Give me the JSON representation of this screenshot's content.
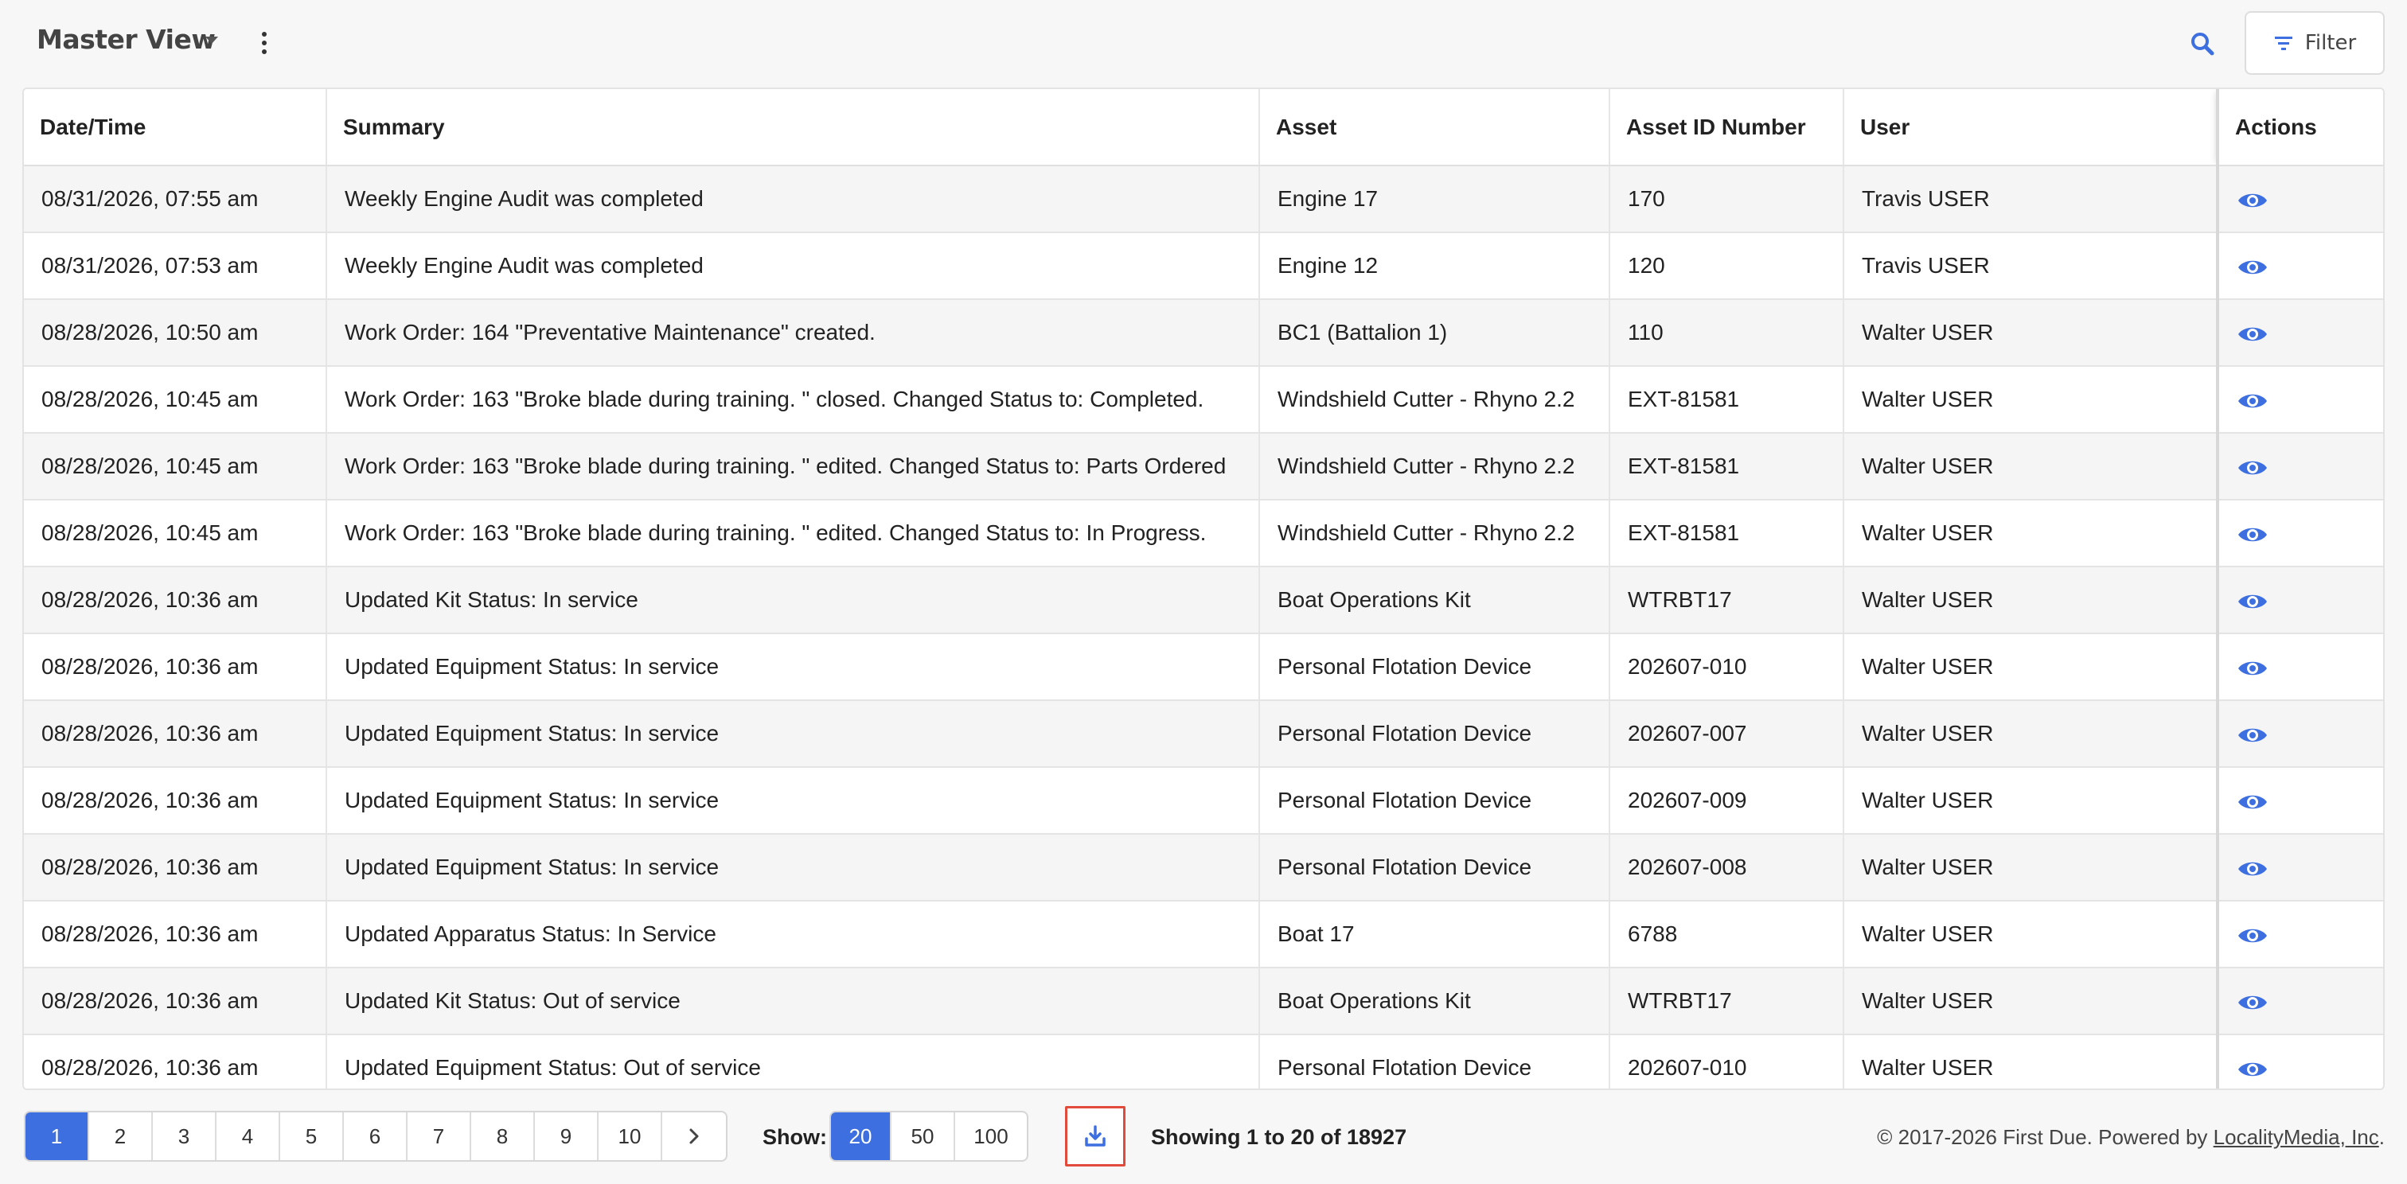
{
  "header": {
    "view_title": "Master View",
    "filter_label": "Filter",
    "search_icon": "search-icon",
    "accent_color": "#3d6fe0"
  },
  "table": {
    "columns": [
      "Date/Time",
      "Summary",
      "Asset",
      "Asset ID Number",
      "User",
      "Actions"
    ],
    "rows": [
      {
        "datetime": "08/31/2026, 07:55 am",
        "summary": "Weekly Engine Audit was completed",
        "asset": "Engine 17",
        "asset_id": "170",
        "user": "Travis USER"
      },
      {
        "datetime": "08/31/2026, 07:53 am",
        "summary": "Weekly Engine Audit was completed",
        "asset": "Engine 12",
        "asset_id": "120",
        "user": "Travis USER"
      },
      {
        "datetime": "08/28/2026, 10:50 am",
        "summary": "Work Order: 164 \"Preventative Maintenance\" created.",
        "asset": "BC1 (Battalion 1)",
        "asset_id": "110",
        "user": "Walter USER"
      },
      {
        "datetime": "08/28/2026, 10:45 am",
        "summary": "Work Order: 163 \"Broke blade during training. \" closed. Changed Status to: Completed.",
        "asset": "Windshield Cutter - Rhyno 2.2",
        "asset_id": "EXT-81581",
        "user": "Walter USER"
      },
      {
        "datetime": "08/28/2026, 10:45 am",
        "summary": "Work Order: 163 \"Broke blade during training. \" edited. Changed Status to: Parts Ordered",
        "asset": "Windshield Cutter - Rhyno 2.2",
        "asset_id": "EXT-81581",
        "user": "Walter USER"
      },
      {
        "datetime": "08/28/2026, 10:45 am",
        "summary": "Work Order: 163 \"Broke blade during training. \" edited. Changed Status to: In Progress.",
        "asset": "Windshield Cutter - Rhyno 2.2",
        "asset_id": "EXT-81581",
        "user": "Walter USER"
      },
      {
        "datetime": "08/28/2026, 10:36 am",
        "summary": "Updated Kit Status: In service",
        "asset": "Boat Operations Kit",
        "asset_id": "WTRBT17",
        "user": "Walter USER"
      },
      {
        "datetime": "08/28/2026, 10:36 am",
        "summary": "Updated Equipment Status: In service",
        "asset": "Personal Flotation Device",
        "asset_id": "202607-010",
        "user": "Walter USER"
      },
      {
        "datetime": "08/28/2026, 10:36 am",
        "summary": "Updated Equipment Status: In service",
        "asset": "Personal Flotation Device",
        "asset_id": "202607-007",
        "user": "Walter USER"
      },
      {
        "datetime": "08/28/2026, 10:36 am",
        "summary": "Updated Equipment Status: In service",
        "asset": "Personal Flotation Device",
        "asset_id": "202607-009",
        "user": "Walter USER"
      },
      {
        "datetime": "08/28/2026, 10:36 am",
        "summary": "Updated Equipment Status: In service",
        "asset": "Personal Flotation Device",
        "asset_id": "202607-008",
        "user": "Walter USER"
      },
      {
        "datetime": "08/28/2026, 10:36 am",
        "summary": "Updated Apparatus Status: In Service",
        "asset": "Boat 17",
        "asset_id": "6788",
        "user": "Walter USER"
      },
      {
        "datetime": "08/28/2026, 10:36 am",
        "summary": "Updated Kit Status: Out of service",
        "asset": "Boat Operations Kit",
        "asset_id": "WTRBT17",
        "user": "Walter USER"
      },
      {
        "datetime": "08/28/2026, 10:36 am",
        "summary": "Updated Equipment Status: Out of service",
        "asset": "Personal Flotation Device",
        "asset_id": "202607-010",
        "user": "Walter USER"
      }
    ],
    "action_icon": "eye-icon"
  },
  "footer": {
    "pages": [
      "1",
      "2",
      "3",
      "4",
      "5",
      "6",
      "7",
      "8",
      "9",
      "10"
    ],
    "active_page": "1",
    "show_label": "Show:",
    "show_options": [
      "20",
      "50",
      "100"
    ],
    "active_show": "20",
    "showing_text": "Showing 1 to 20 of 18927",
    "copyright_prefix": "© 2017-2026 First Due. Powered by ",
    "copyright_link": "LocalityMedia, Inc",
    "copyright_suffix": "."
  }
}
